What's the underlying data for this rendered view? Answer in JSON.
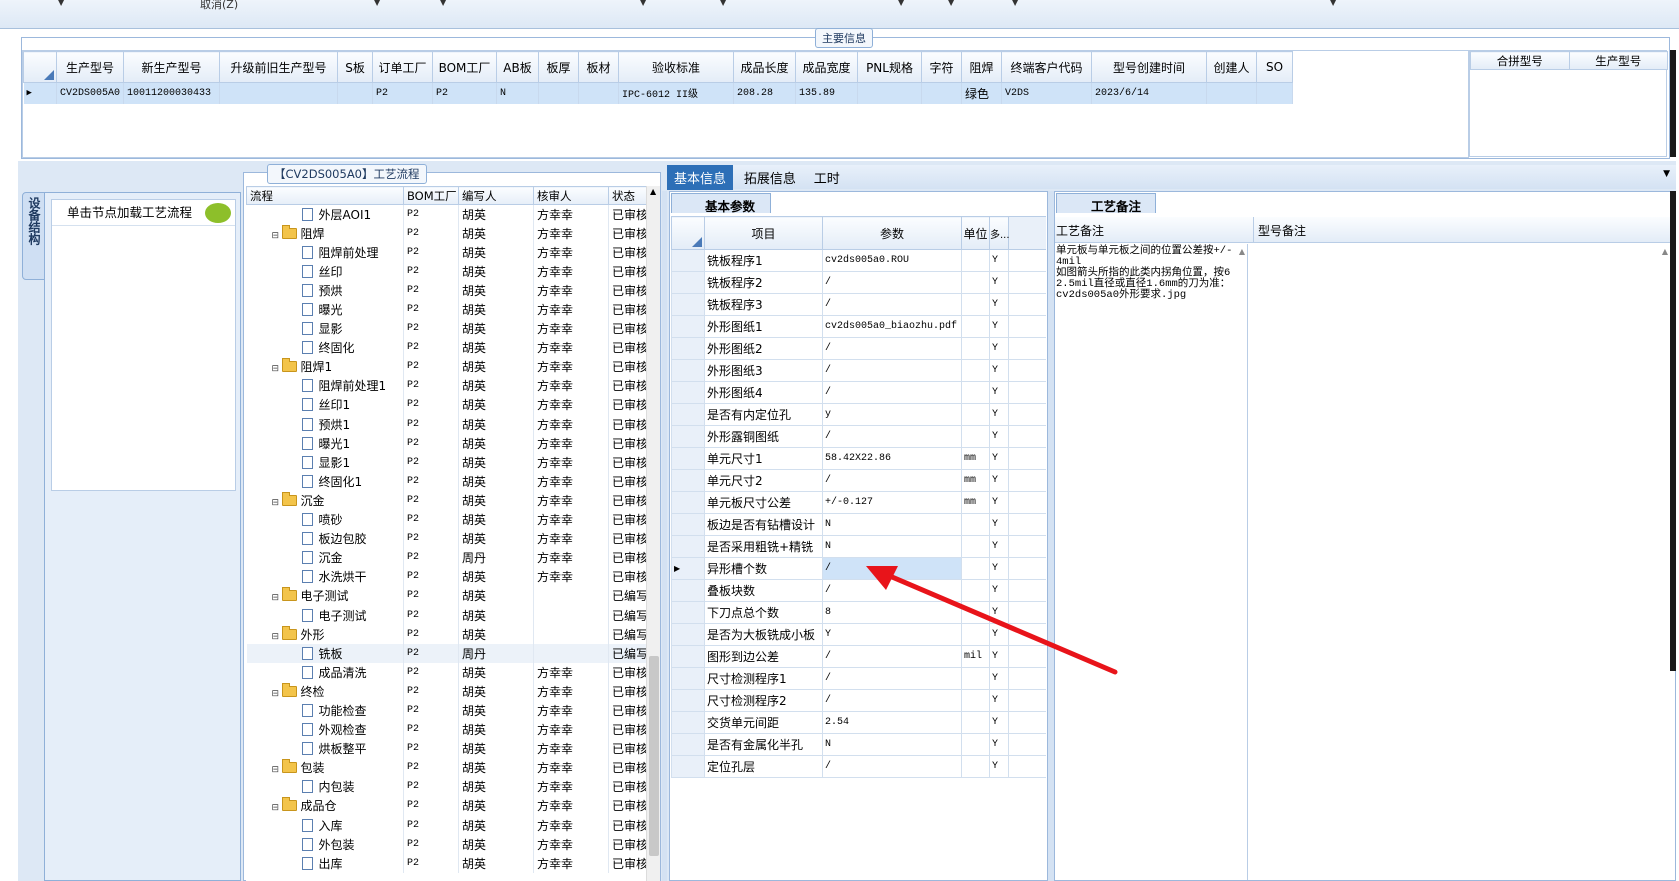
{
  "toolbar": {
    "cancel_label": "取消(Z)"
  },
  "main_info": {
    "group_title": "主要信息",
    "columns": [
      "生产型号",
      "新生产型号",
      "升级前旧生产型号",
      "S板",
      "订单工厂",
      "BOM工厂",
      "AB板",
      "板厚",
      "板材",
      "验收标准",
      "成品长度",
      "成品宽度",
      "PNL规格",
      "字符",
      "阻焊",
      "终端客户代码",
      "型号创建时间",
      "创建人",
      "SO"
    ],
    "row": [
      "CV2DS005A0",
      "10011200030433",
      "",
      "",
      "P2",
      "P2",
      "N",
      "",
      "",
      "IPC-6012 II级",
      "208.28",
      "135.89",
      "",
      "",
      "绿色",
      "V2DS",
      "2023/6/14",
      "",
      ""
    ],
    "side_columns": [
      "合拼型号",
      "生产型号"
    ]
  },
  "left_panel": {
    "vertical_tab": "设备结构",
    "header": "单击节点加载工艺流程"
  },
  "flow": {
    "group_title": "【CV2DS005A0】工艺流程",
    "columns": [
      "流程",
      "BOM工厂",
      "编写人",
      "核审人",
      "状态"
    ],
    "rows": [
      {
        "level": 2,
        "name": "外层AOI1",
        "bom": "P2",
        "writer": "胡英",
        "reviewer": "方幸幸",
        "status": "已审核"
      },
      {
        "level": 1,
        "name": "阻焊",
        "bom": "P2",
        "writer": "胡英",
        "reviewer": "方幸幸",
        "status": "已审核"
      },
      {
        "level": 2,
        "name": "阻焊前处理",
        "bom": "P2",
        "writer": "胡英",
        "reviewer": "方幸幸",
        "status": "已审核"
      },
      {
        "level": 2,
        "name": "丝印",
        "bom": "P2",
        "writer": "胡英",
        "reviewer": "方幸幸",
        "status": "已审核"
      },
      {
        "level": 2,
        "name": "预烘",
        "bom": "P2",
        "writer": "胡英",
        "reviewer": "方幸幸",
        "status": "已审核"
      },
      {
        "level": 2,
        "name": "曝光",
        "bom": "P2",
        "writer": "胡英",
        "reviewer": "方幸幸",
        "status": "已审核"
      },
      {
        "level": 2,
        "name": "显影",
        "bom": "P2",
        "writer": "胡英",
        "reviewer": "方幸幸",
        "status": "已审核"
      },
      {
        "level": 2,
        "name": "终固化",
        "bom": "P2",
        "writer": "胡英",
        "reviewer": "方幸幸",
        "status": "已审核"
      },
      {
        "level": 1,
        "name": "阻焊1",
        "bom": "P2",
        "writer": "胡英",
        "reviewer": "方幸幸",
        "status": "已审核"
      },
      {
        "level": 2,
        "name": "阻焊前处理1",
        "bom": "P2",
        "writer": "胡英",
        "reviewer": "方幸幸",
        "status": "已审核"
      },
      {
        "level": 2,
        "name": "丝印1",
        "bom": "P2",
        "writer": "胡英",
        "reviewer": "方幸幸",
        "status": "已审核"
      },
      {
        "level": 2,
        "name": "预烘1",
        "bom": "P2",
        "writer": "胡英",
        "reviewer": "方幸幸",
        "status": "已审核"
      },
      {
        "level": 2,
        "name": "曝光1",
        "bom": "P2",
        "writer": "胡英",
        "reviewer": "方幸幸",
        "status": "已审核"
      },
      {
        "level": 2,
        "name": "显影1",
        "bom": "P2",
        "writer": "胡英",
        "reviewer": "方幸幸",
        "status": "已审核"
      },
      {
        "level": 2,
        "name": "终固化1",
        "bom": "P2",
        "writer": "胡英",
        "reviewer": "方幸幸",
        "status": "已审核"
      },
      {
        "level": 1,
        "name": "沉金",
        "bom": "P2",
        "writer": "胡英",
        "reviewer": "方幸幸",
        "status": "已审核"
      },
      {
        "level": 2,
        "name": "喷砂",
        "bom": "P2",
        "writer": "胡英",
        "reviewer": "方幸幸",
        "status": "已审核"
      },
      {
        "level": 2,
        "name": "板边包胶",
        "bom": "P2",
        "writer": "胡英",
        "reviewer": "方幸幸",
        "status": "已审核"
      },
      {
        "level": 2,
        "name": "沉金",
        "bom": "P2",
        "writer": "周丹",
        "reviewer": "方幸幸",
        "status": "已审核"
      },
      {
        "level": 2,
        "name": "水洗烘干",
        "bom": "P2",
        "writer": "胡英",
        "reviewer": "方幸幸",
        "status": "已审核"
      },
      {
        "level": 1,
        "name": "电子测试",
        "bom": "P2",
        "writer": "胡英",
        "reviewer": "",
        "status": "已编写"
      },
      {
        "level": 2,
        "name": "电子测试",
        "bom": "P2",
        "writer": "胡英",
        "reviewer": "",
        "status": "已编写"
      },
      {
        "level": 1,
        "name": "外形",
        "bom": "P2",
        "writer": "胡英",
        "reviewer": "",
        "status": "已编写"
      },
      {
        "level": 2,
        "name": "铣板",
        "bom": "P2",
        "writer": "周丹",
        "reviewer": "",
        "status": "已编写",
        "selected": true
      },
      {
        "level": 2,
        "name": "成品清洗",
        "bom": "P2",
        "writer": "胡英",
        "reviewer": "方幸幸",
        "status": "已审核"
      },
      {
        "level": 1,
        "name": "终检",
        "bom": "P2",
        "writer": "胡英",
        "reviewer": "方幸幸",
        "status": "已审核"
      },
      {
        "level": 2,
        "name": "功能检查",
        "bom": "P2",
        "writer": "胡英",
        "reviewer": "方幸幸",
        "status": "已审核"
      },
      {
        "level": 2,
        "name": "外观检查",
        "bom": "P2",
        "writer": "胡英",
        "reviewer": "方幸幸",
        "status": "已审核"
      },
      {
        "level": 2,
        "name": "烘板整平",
        "bom": "P2",
        "writer": "胡英",
        "reviewer": "方幸幸",
        "status": "已审核"
      },
      {
        "level": 1,
        "name": "包装",
        "bom": "P2",
        "writer": "胡英",
        "reviewer": "方幸幸",
        "status": "已审核"
      },
      {
        "level": 2,
        "name": "内包装",
        "bom": "P2",
        "writer": "胡英",
        "reviewer": "方幸幸",
        "status": "已审核"
      },
      {
        "level": 1,
        "name": "成品仓",
        "bom": "P2",
        "writer": "胡英",
        "reviewer": "方幸幸",
        "status": "已审核"
      },
      {
        "level": 2,
        "name": "入库",
        "bom": "P2",
        "writer": "胡英",
        "reviewer": "方幸幸",
        "status": "已审核"
      },
      {
        "level": 2,
        "name": "外包装",
        "bom": "P2",
        "writer": "胡英",
        "reviewer": "方幸幸",
        "status": "已审核"
      },
      {
        "level": 2,
        "name": "出库",
        "bom": "P2",
        "writer": "胡英",
        "reviewer": "方幸幸",
        "status": "已审核"
      }
    ]
  },
  "tabs": [
    "基本信息",
    "拓展信息",
    "工时"
  ],
  "basic_params": {
    "tab_label": "基本参数",
    "columns": [
      "项目",
      "参数",
      "单位",
      "多..."
    ],
    "rows": [
      {
        "item": "铣板程序1",
        "value": "cv2ds005a0.ROU",
        "unit": "",
        "flag": "Y"
      },
      {
        "item": "铣板程序2",
        "value": "/",
        "unit": "",
        "flag": "Y"
      },
      {
        "item": "铣板程序3",
        "value": "/",
        "unit": "",
        "flag": "Y"
      },
      {
        "item": "外形图纸1",
        "value": "cv2ds005a0_biaozhu.pdf",
        "unit": "",
        "flag": "Y"
      },
      {
        "item": "外形图纸2",
        "value": "/",
        "unit": "",
        "flag": "Y"
      },
      {
        "item": "外形图纸3",
        "value": "/",
        "unit": "",
        "flag": "Y"
      },
      {
        "item": "外形图纸4",
        "value": "/",
        "unit": "",
        "flag": "Y"
      },
      {
        "item": "是否有内定位孔",
        "value": "y",
        "unit": "",
        "flag": "Y"
      },
      {
        "item": "外形露铜图纸",
        "value": "/",
        "unit": "",
        "flag": "Y"
      },
      {
        "item": "单元尺寸1",
        "value": "58.42X22.86",
        "unit": "mm",
        "flag": "Y"
      },
      {
        "item": "单元尺寸2",
        "value": "/",
        "unit": "mm",
        "flag": "Y"
      },
      {
        "item": "单元板尺寸公差",
        "value": "+/-0.127",
        "unit": "mm",
        "flag": "Y"
      },
      {
        "item": "板边是否有钻槽设计",
        "value": "N",
        "unit": "",
        "flag": "Y"
      },
      {
        "item": "是否采用粗铣+精铣",
        "value": "N",
        "unit": "",
        "flag": "Y"
      },
      {
        "item": "异形槽个数",
        "value": "/",
        "unit": "",
        "flag": "Y",
        "current": true
      },
      {
        "item": "叠板块数",
        "value": "/",
        "unit": "",
        "flag": "Y"
      },
      {
        "item": "下刀点总个数",
        "value": "8",
        "unit": "",
        "flag": "Y"
      },
      {
        "item": "是否为大板铣成小板",
        "value": "Y",
        "unit": "",
        "flag": "Y"
      },
      {
        "item": "图形到边公差",
        "value": "/",
        "unit": "mil",
        "flag": "Y"
      },
      {
        "item": "尺寸检测程序1",
        "value": "/",
        "unit": "",
        "flag": "Y"
      },
      {
        "item": "尺寸检测程序2",
        "value": "/",
        "unit": "",
        "flag": "Y"
      },
      {
        "item": "交货单元间距",
        "value": "2.54",
        "unit": "",
        "flag": "Y"
      },
      {
        "item": "是否有金属化半孔",
        "value": "N",
        "unit": "",
        "flag": "Y"
      },
      {
        "item": "定位孔层",
        "value": "/",
        "unit": "",
        "flag": "Y"
      }
    ]
  },
  "remarks": {
    "tab_label": "工艺备注",
    "process_header": "工艺备注",
    "model_header": "型号备注",
    "process_text": "单元板与单元板之间的位置公差按+/-4mil\n如图箭头所指的此类内拐角位置，按62.5mil直径或直径1.6mm的刀为准：cv2ds005a0外形要求.jpg"
  },
  "colors": {
    "accent": "#2d6fb7",
    "selection": "#cfe3f8",
    "arrow": "#e8141a"
  }
}
